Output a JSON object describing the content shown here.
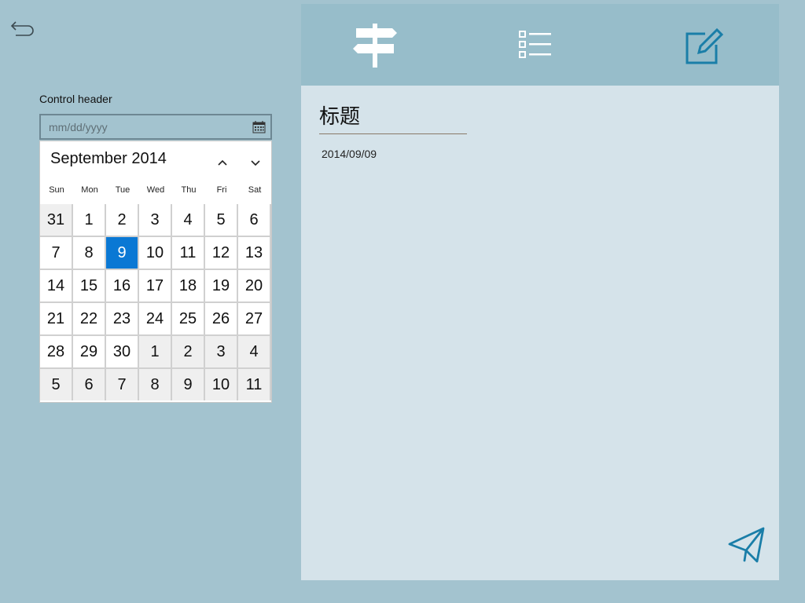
{
  "form": {
    "control_header": "Control header",
    "date_placeholder": "mm/dd/yyyy"
  },
  "calendar": {
    "month_label": "September 2014",
    "weekdays": [
      "Sun",
      "Mon",
      "Tue",
      "Wed",
      "Thu",
      "Fri",
      "Sat"
    ],
    "days": [
      {
        "n": "31",
        "other": true
      },
      {
        "n": "1"
      },
      {
        "n": "2"
      },
      {
        "n": "3"
      },
      {
        "n": "4"
      },
      {
        "n": "5"
      },
      {
        "n": "6"
      },
      {
        "n": "7"
      },
      {
        "n": "8"
      },
      {
        "n": "9",
        "selected": true
      },
      {
        "n": "10"
      },
      {
        "n": "11"
      },
      {
        "n": "12"
      },
      {
        "n": "13"
      },
      {
        "n": "14"
      },
      {
        "n": "15"
      },
      {
        "n": "16"
      },
      {
        "n": "17"
      },
      {
        "n": "18"
      },
      {
        "n": "19"
      },
      {
        "n": "20"
      },
      {
        "n": "21"
      },
      {
        "n": "22"
      },
      {
        "n": "23"
      },
      {
        "n": "24"
      },
      {
        "n": "25"
      },
      {
        "n": "26"
      },
      {
        "n": "27"
      },
      {
        "n": "28"
      },
      {
        "n": "29"
      },
      {
        "n": "30"
      },
      {
        "n": "1",
        "other": true
      },
      {
        "n": "2",
        "other": true
      },
      {
        "n": "3",
        "other": true
      },
      {
        "n": "4",
        "other": true
      },
      {
        "n": "5",
        "other": true
      },
      {
        "n": "6",
        "other": true
      },
      {
        "n": "7",
        "other": true
      },
      {
        "n": "8",
        "other": true
      },
      {
        "n": "9",
        "other": true
      },
      {
        "n": "10",
        "other": true
      },
      {
        "n": "11",
        "other": true
      }
    ],
    "selected_color": "#0a78d4"
  },
  "note": {
    "title": "标题",
    "date": "2014/09/09"
  },
  "icons": {
    "back": "back-arrow-icon",
    "calendar": "calendar-icon",
    "signpost": "signpost-icon",
    "list": "list-icon",
    "edit": "edit-icon",
    "send": "send-icon"
  },
  "colors": {
    "accent": "#0a78d4",
    "toolbar": "#97bdca",
    "panel": "#d5e3ea",
    "background": "#a3c3cf"
  }
}
